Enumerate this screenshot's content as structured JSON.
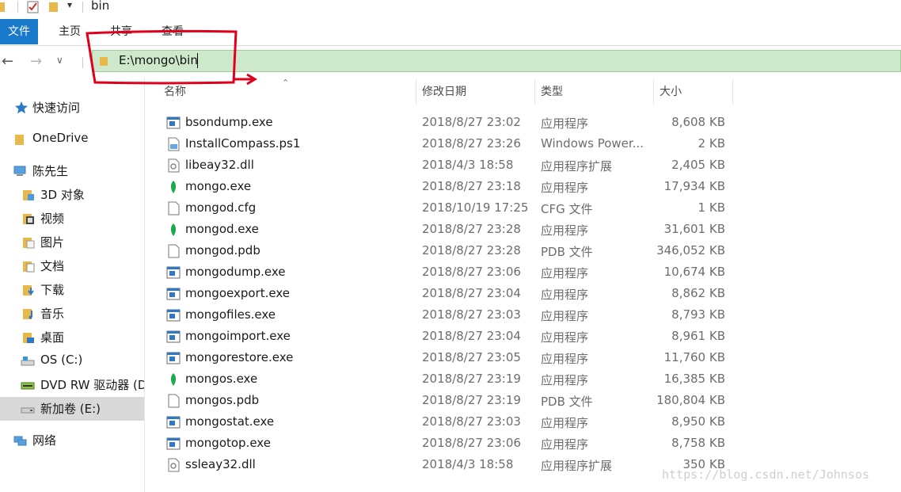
{
  "window": {
    "title": "bin"
  },
  "ribbon": {
    "tabs": [
      {
        "label": "文件"
      },
      {
        "label": "主页"
      },
      {
        "label": "共享"
      },
      {
        "label": "查看"
      }
    ]
  },
  "address": {
    "path": "E:\\mongo\\bin"
  },
  "sidebar": {
    "items": [
      {
        "label": "快速访问",
        "icon": "star-icon"
      },
      {
        "label": "OneDrive",
        "icon": "cloud-folder-icon"
      },
      {
        "label": "陈先生",
        "icon": "computer-icon"
      },
      {
        "label": "3D 对象",
        "icon": "cube-folder-icon"
      },
      {
        "label": "视频",
        "icon": "video-folder-icon"
      },
      {
        "label": "图片",
        "icon": "picture-folder-icon"
      },
      {
        "label": "文档",
        "icon": "document-folder-icon"
      },
      {
        "label": "下载",
        "icon": "download-folder-icon"
      },
      {
        "label": "音乐",
        "icon": "music-folder-icon"
      },
      {
        "label": "桌面",
        "icon": "desktop-folder-icon"
      },
      {
        "label": "OS (C:)",
        "icon": "drive-icon"
      },
      {
        "label": "DVD RW 驱动器 (D",
        "icon": "dvd-drive-icon"
      },
      {
        "label": "新加卷 (E:)",
        "icon": "drive-icon",
        "selected": true
      },
      {
        "label": "网络",
        "icon": "network-icon"
      }
    ]
  },
  "columns": {
    "name": "名称",
    "date": "修改日期",
    "type": "类型",
    "size": "大小"
  },
  "files": [
    {
      "name": "bsondump.exe",
      "date": "2018/8/27 23:02",
      "type": "应用程序",
      "size": "8,608 KB",
      "icon": "exe"
    },
    {
      "name": "InstallCompass.ps1",
      "date": "2018/8/27 23:26",
      "type": "Windows Power...",
      "size": "2 KB",
      "icon": "script"
    },
    {
      "name": "libeay32.dll",
      "date": "2018/4/3 18:58",
      "type": "应用程序扩展",
      "size": "2,405 KB",
      "icon": "dll"
    },
    {
      "name": "mongo.exe",
      "date": "2018/8/27 23:18",
      "type": "应用程序",
      "size": "17,934 KB",
      "icon": "leaf"
    },
    {
      "name": "mongod.cfg",
      "date": "2018/10/19 17:25",
      "type": "CFG 文件",
      "size": "1 KB",
      "icon": "blank"
    },
    {
      "name": "mongod.exe",
      "date": "2018/8/27 23:28",
      "type": "应用程序",
      "size": "31,601 KB",
      "icon": "leaf"
    },
    {
      "name": "mongod.pdb",
      "date": "2018/8/27 23:28",
      "type": "PDB 文件",
      "size": "346,052 KB",
      "icon": "blank"
    },
    {
      "name": "mongodump.exe",
      "date": "2018/8/27 23:06",
      "type": "应用程序",
      "size": "10,674 KB",
      "icon": "exe"
    },
    {
      "name": "mongoexport.exe",
      "date": "2018/8/27 23:04",
      "type": "应用程序",
      "size": "8,862 KB",
      "icon": "exe"
    },
    {
      "name": "mongofiles.exe",
      "date": "2018/8/27 23:03",
      "type": "应用程序",
      "size": "8,793 KB",
      "icon": "exe"
    },
    {
      "name": "mongoimport.exe",
      "date": "2018/8/27 23:04",
      "type": "应用程序",
      "size": "8,961 KB",
      "icon": "exe"
    },
    {
      "name": "mongorestore.exe",
      "date": "2018/8/27 23:05",
      "type": "应用程序",
      "size": "11,760 KB",
      "icon": "exe"
    },
    {
      "name": "mongos.exe",
      "date": "2018/8/27 23:19",
      "type": "应用程序",
      "size": "16,385 KB",
      "icon": "leaf"
    },
    {
      "name": "mongos.pdb",
      "date": "2018/8/27 23:19",
      "type": "PDB 文件",
      "size": "180,804 KB",
      "icon": "blank"
    },
    {
      "name": "mongostat.exe",
      "date": "2018/8/27 23:03",
      "type": "应用程序",
      "size": "8,950 KB",
      "icon": "exe"
    },
    {
      "name": "mongotop.exe",
      "date": "2018/8/27 23:06",
      "type": "应用程序",
      "size": "8,758 KB",
      "icon": "exe"
    },
    {
      "name": "ssleay32.dll",
      "date": "2018/4/3 18:58",
      "type": "应用程序扩展",
      "size": "350 KB",
      "icon": "dll"
    }
  ],
  "watermark": "https://blog.csdn.net/Johnsos",
  "colors": {
    "accent": "#1979ca",
    "address_bg": "#cde8cb",
    "annotation": "#e0001b",
    "leaf": "#1fa84b"
  }
}
